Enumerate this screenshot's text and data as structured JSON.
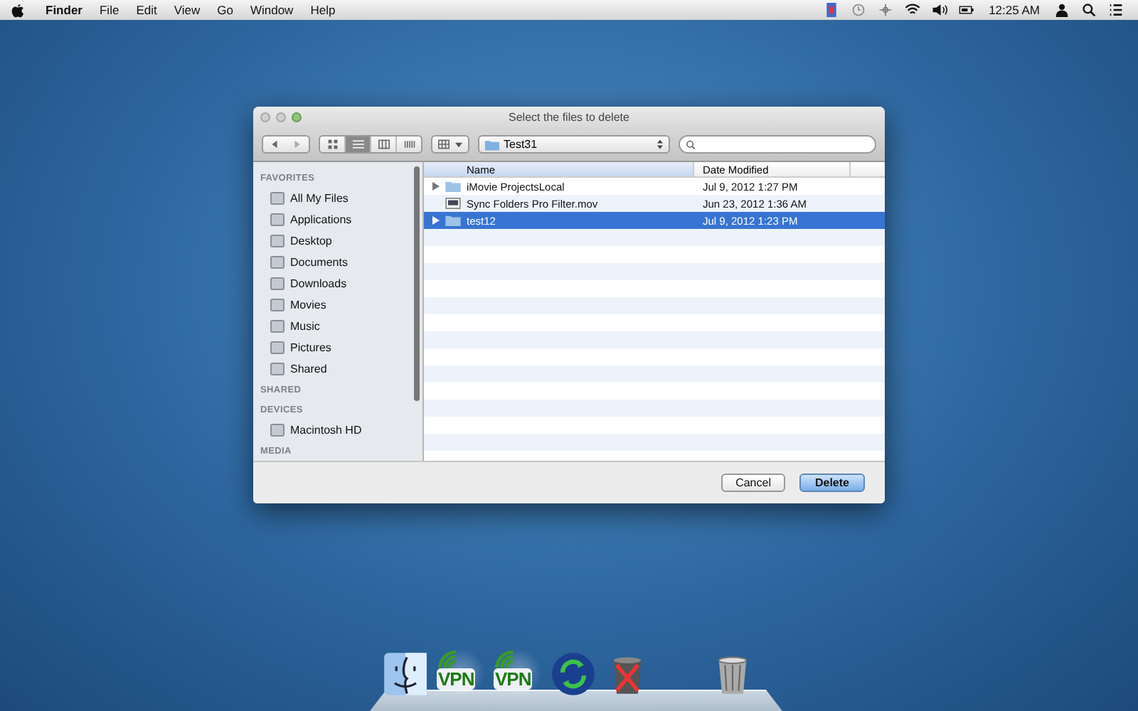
{
  "menu_bar": {
    "app": "Finder",
    "menus": [
      "File",
      "Edit",
      "View",
      "Go",
      "Window",
      "Help"
    ],
    "clock": "12:25 AM"
  },
  "dialog": {
    "title": "Select the files to delete",
    "view_modes": [
      {
        "selected": false
      },
      {
        "selected": true
      },
      {
        "selected": false
      },
      {
        "selected": false
      }
    ],
    "location": "Test31",
    "sidebar": [
      {
        "heading": "FAVORITES",
        "items": [
          "All My Files",
          "Applications",
          "Desktop",
          "Documents",
          "Downloads",
          "Movies",
          "Music",
          "Pictures",
          "Shared"
        ]
      },
      {
        "heading": "SHARED"
      },
      {
        "heading": "DEVICES",
        "items": [
          "Macintosh HD"
        ]
      },
      {
        "heading": "MEDIA"
      }
    ],
    "columns": [
      "Name",
      "Date Modified"
    ],
    "rows": [
      {
        "name": "iMovie ProjectsLocal",
        "date": "Jul 9, 2012 1:27 PM",
        "kind": "folder",
        "selected": false
      },
      {
        "name": "Sync Folders Pro Filter.mov",
        "date": "Jun 23, 2012 1:36 AM",
        "kind": "movie",
        "selected": false
      },
      {
        "name": "test12",
        "date": "Jul 9, 2012 1:23 PM",
        "kind": "folder",
        "selected": true
      }
    ],
    "buttons": [
      {
        "label": "Cancel",
        "kind": "normal"
      },
      {
        "label": "Delete",
        "kind": "default"
      }
    ]
  },
  "dock": {
    "vpn_labels": [
      "VPN",
      "VPN"
    ]
  }
}
